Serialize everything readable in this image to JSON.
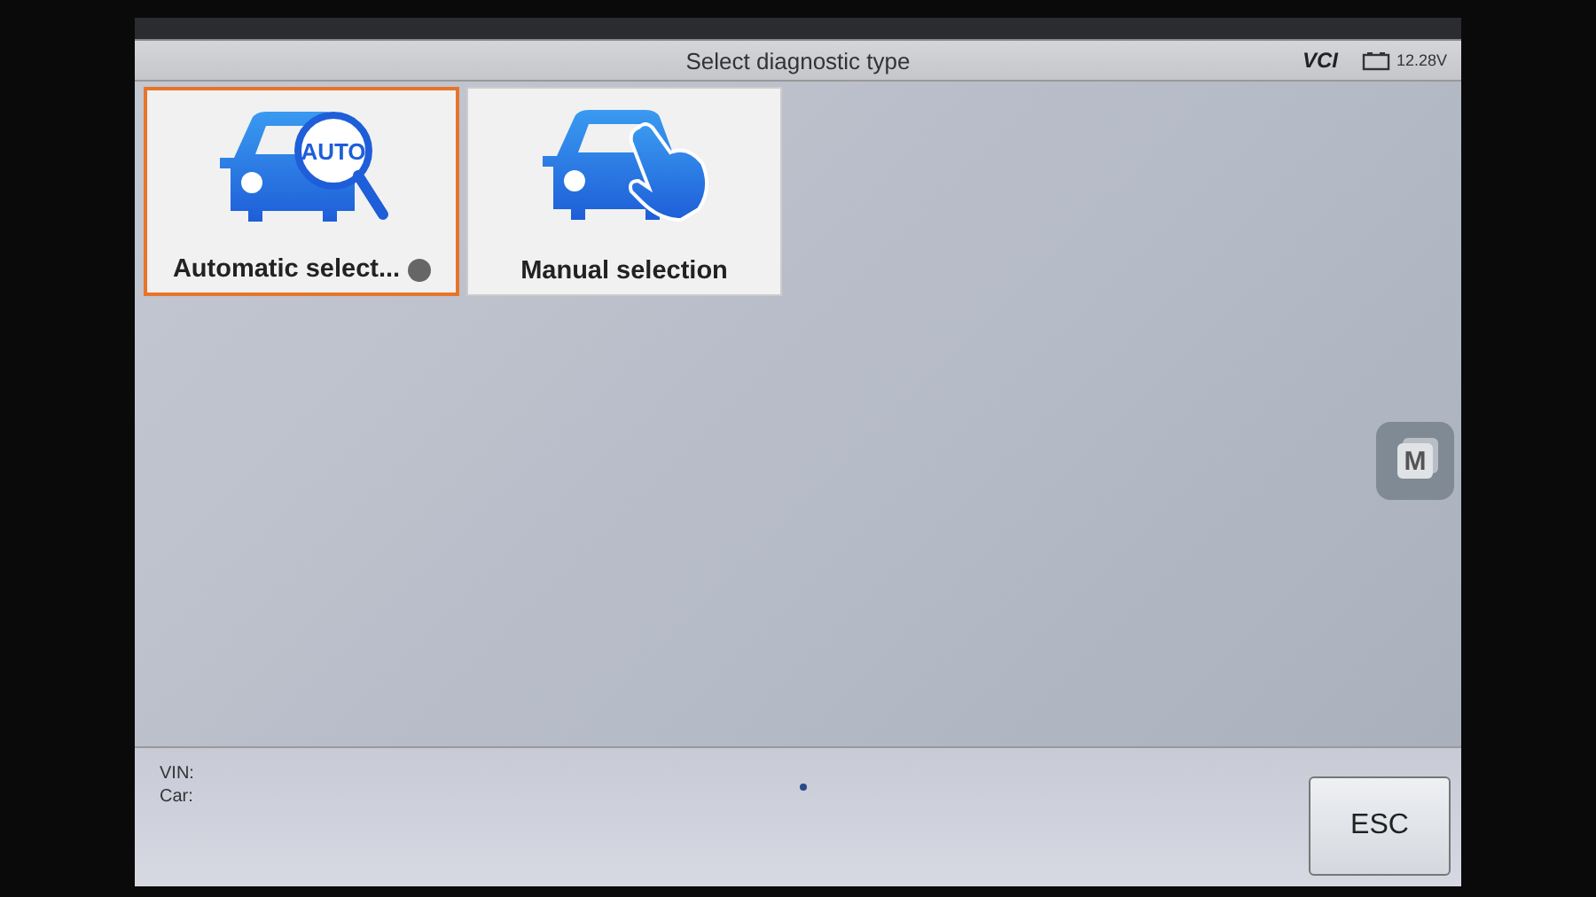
{
  "title_bar": {
    "title": "Select diagnostic type",
    "vci_label": "VCI",
    "voltage": "12.28V"
  },
  "tiles": [
    {
      "kind": "auto",
      "label": "Automatic select...",
      "badge": "AUTO",
      "info": true,
      "selected": true
    },
    {
      "kind": "manual",
      "label": "Manual selection",
      "info": false,
      "selected": false
    }
  ],
  "float_button": {
    "label": "M"
  },
  "footer": {
    "vin_label": "VIN:",
    "car_label": "Car:",
    "esc": "ESC"
  }
}
